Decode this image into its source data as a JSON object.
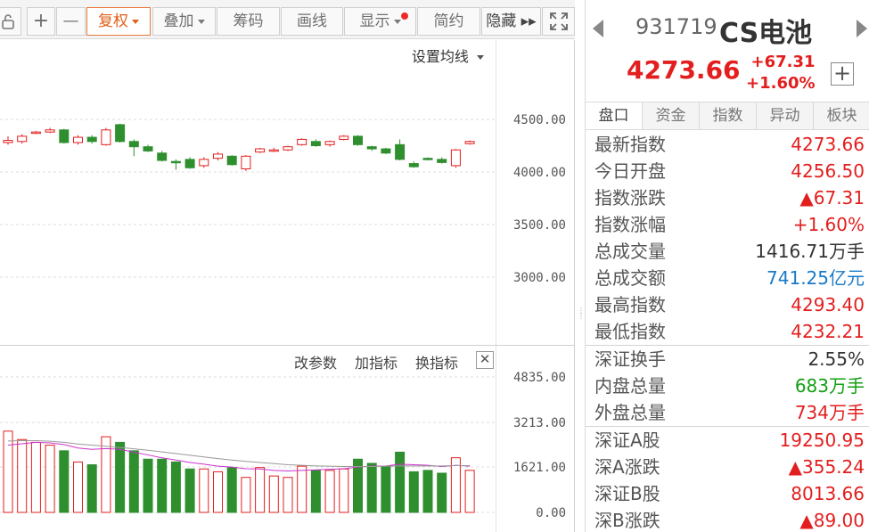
{
  "toolbar": {
    "buttons": [
      {
        "label": "+"
      },
      {
        "label": "—"
      },
      {
        "label": "复权"
      },
      {
        "label": "叠加"
      },
      {
        "label": "筹码"
      },
      {
        "label": "画线"
      },
      {
        "label": "显示"
      },
      {
        "label": "简约"
      },
      {
        "label": "隐藏 ▸▸"
      }
    ]
  },
  "chart": {
    "ma_setting": "设置均线",
    "price_ticks": [
      "4500.00",
      "4000.00",
      "3500.00",
      "3000.00"
    ],
    "volume_ticks": [
      "4835.00",
      "3213.00",
      "1621.00",
      "0.00"
    ],
    "indicator_actions": [
      "改参数",
      "加指标",
      "换指标"
    ],
    "close_symbol": "✕"
  },
  "colors": {
    "up": "#e31e1e",
    "down": "#2f8f2f",
    "ma_line": "#cc33cc",
    "ma_line2": "#999999",
    "accent": "#e0601b",
    "blue": "#1b7ac8"
  },
  "chart_data": {
    "type": "candlestick",
    "price_axis": [
      3000,
      4500
    ],
    "volume_axis": [
      0,
      4835
    ],
    "candles": [
      {
        "o": 4280,
        "c": 4300,
        "h": 4340,
        "l": 4260
      },
      {
        "o": 4290,
        "c": 4340,
        "h": 4360,
        "l": 4270
      },
      {
        "o": 4370,
        "c": 4380,
        "h": 4390,
        "l": 4360
      },
      {
        "o": 4380,
        "c": 4400,
        "h": 4420,
        "l": 4370
      },
      {
        "o": 4400,
        "c": 4280,
        "h": 4410,
        "l": 4270
      },
      {
        "o": 4280,
        "c": 4330,
        "h": 4350,
        "l": 4260
      },
      {
        "o": 4330,
        "c": 4290,
        "h": 4350,
        "l": 4270
      },
      {
        "o": 4260,
        "c": 4400,
        "h": 4420,
        "l": 4250
      },
      {
        "o": 4450,
        "c": 4290,
        "h": 4460,
        "l": 4280
      },
      {
        "o": 4290,
        "c": 4240,
        "h": 4310,
        "l": 4150
      },
      {
        "o": 4240,
        "c": 4200,
        "h": 4260,
        "l": 4190
      },
      {
        "o": 4180,
        "c": 4110,
        "h": 4200,
        "l": 4100
      },
      {
        "o": 4100,
        "c": 4090,
        "h": 4120,
        "l": 4020
      },
      {
        "o": 4120,
        "c": 4040,
        "h": 4140,
        "l": 4030
      },
      {
        "o": 4060,
        "c": 4120,
        "h": 4140,
        "l": 4040
      },
      {
        "o": 4130,
        "c": 4170,
        "h": 4190,
        "l": 4110
      },
      {
        "o": 4150,
        "c": 4070,
        "h": 4160,
        "l": 4060
      },
      {
        "o": 4030,
        "c": 4150,
        "h": 4160,
        "l": 4010
      },
      {
        "o": 4190,
        "c": 4220,
        "h": 4230,
        "l": 4180
      },
      {
        "o": 4200,
        "c": 4210,
        "h": 4230,
        "l": 4190
      },
      {
        "o": 4210,
        "c": 4240,
        "h": 4250,
        "l": 4200
      },
      {
        "o": 4260,
        "c": 4310,
        "h": 4320,
        "l": 4250
      },
      {
        "o": 4290,
        "c": 4250,
        "h": 4310,
        "l": 4240
      },
      {
        "o": 4260,
        "c": 4290,
        "h": 4300,
        "l": 4240
      },
      {
        "o": 4310,
        "c": 4340,
        "h": 4350,
        "l": 4300
      },
      {
        "o": 4340,
        "c": 4260,
        "h": 4350,
        "l": 4250
      },
      {
        "o": 4240,
        "c": 4220,
        "h": 4250,
        "l": 4200
      },
      {
        "o": 4220,
        "c": 4180,
        "h": 4230,
        "l": 4170
      },
      {
        "o": 4260,
        "c": 4120,
        "h": 4310,
        "l": 4110
      },
      {
        "o": 4080,
        "c": 4050,
        "h": 4100,
        "l": 4040
      },
      {
        "o": 4130,
        "c": 4120,
        "h": 4140,
        "l": 4110
      },
      {
        "o": 4120,
        "c": 4090,
        "h": 4140,
        "l": 4080
      },
      {
        "o": 4060,
        "c": 4210,
        "h": 4220,
        "l": 4040
      },
      {
        "o": 4270,
        "c": 4290,
        "h": 4300,
        "l": 4260
      }
    ],
    "volumes": [
      2900,
      2600,
      2500,
      2400,
      2200,
      1800,
      1700,
      2700,
      2500,
      2200,
      1900,
      1900,
      1800,
      1550,
      1550,
      1450,
      1600,
      1250,
      1600,
      1300,
      1250,
      1650,
      1500,
      1500,
      1550,
      1900,
      1750,
      1650,
      2150,
      1450,
      1500,
      1400,
      1950,
      1500
    ],
    "ma_series": [
      {
        "values": [
          2400,
          2450,
          2500,
          2480,
          2420,
          2300,
          2250,
          2280,
          2250,
          2150,
          2050,
          1950,
          1870,
          1780,
          1720,
          1650,
          1620,
          1560,
          1550,
          1500,
          1480,
          1500,
          1520,
          1540,
          1560,
          1620,
          1650,
          1660,
          1720,
          1700,
          1680,
          1640,
          1680,
          1650
        ]
      },
      {
        "values": [
          2550,
          2560,
          2560,
          2540,
          2500,
          2440,
          2400,
          2360,
          2320,
          2270,
          2220,
          2160,
          2100,
          2040,
          1980,
          1920,
          1870,
          1820,
          1780,
          1740,
          1700,
          1680,
          1660,
          1650,
          1640,
          1640,
          1640,
          1650,
          1660,
          1660,
          1660,
          1660,
          1670,
          1670
        ]
      }
    ]
  },
  "quote": {
    "code": "931719",
    "name": "CS电池",
    "price": "4273.66",
    "change": "+67.31",
    "change_pct": "+1.60%",
    "tabs": [
      "盘口",
      "资金",
      "指数",
      "异动",
      "板块"
    ],
    "group1": [
      {
        "label": "最新指数",
        "value": "4273.66",
        "color": "red"
      },
      {
        "label": "今日开盘",
        "value": "4256.50",
        "color": "red"
      },
      {
        "label": "指数涨跌",
        "value": "▲67.31",
        "color": "red"
      },
      {
        "label": "指数涨幅",
        "value": "+1.60%",
        "color": "red"
      },
      {
        "label": "总成交量",
        "value": "1416.71万手",
        "color": "dark"
      },
      {
        "label": "总成交额",
        "value": "741.25亿元",
        "color": "blue"
      },
      {
        "label": "最高指数",
        "value": "4293.40",
        "color": "red"
      },
      {
        "label": "最低指数",
        "value": "4232.21",
        "color": "red"
      }
    ],
    "group2": [
      {
        "label": "深证换手",
        "value": "2.55%",
        "color": "dark"
      },
      {
        "label": "内盘总量",
        "value": "683万手",
        "color": "green"
      },
      {
        "label": "外盘总量",
        "value": "734万手",
        "color": "red"
      }
    ],
    "group3": [
      {
        "label": "深证A股",
        "value": "19250.95",
        "color": "red"
      },
      {
        "label": "深A涨跌",
        "value": "▲355.24",
        "color": "red"
      },
      {
        "label": "深证B股",
        "value": "8013.66",
        "color": "red"
      },
      {
        "label": "深B涨跌",
        "value": "▲89.00",
        "color": "red"
      }
    ]
  }
}
